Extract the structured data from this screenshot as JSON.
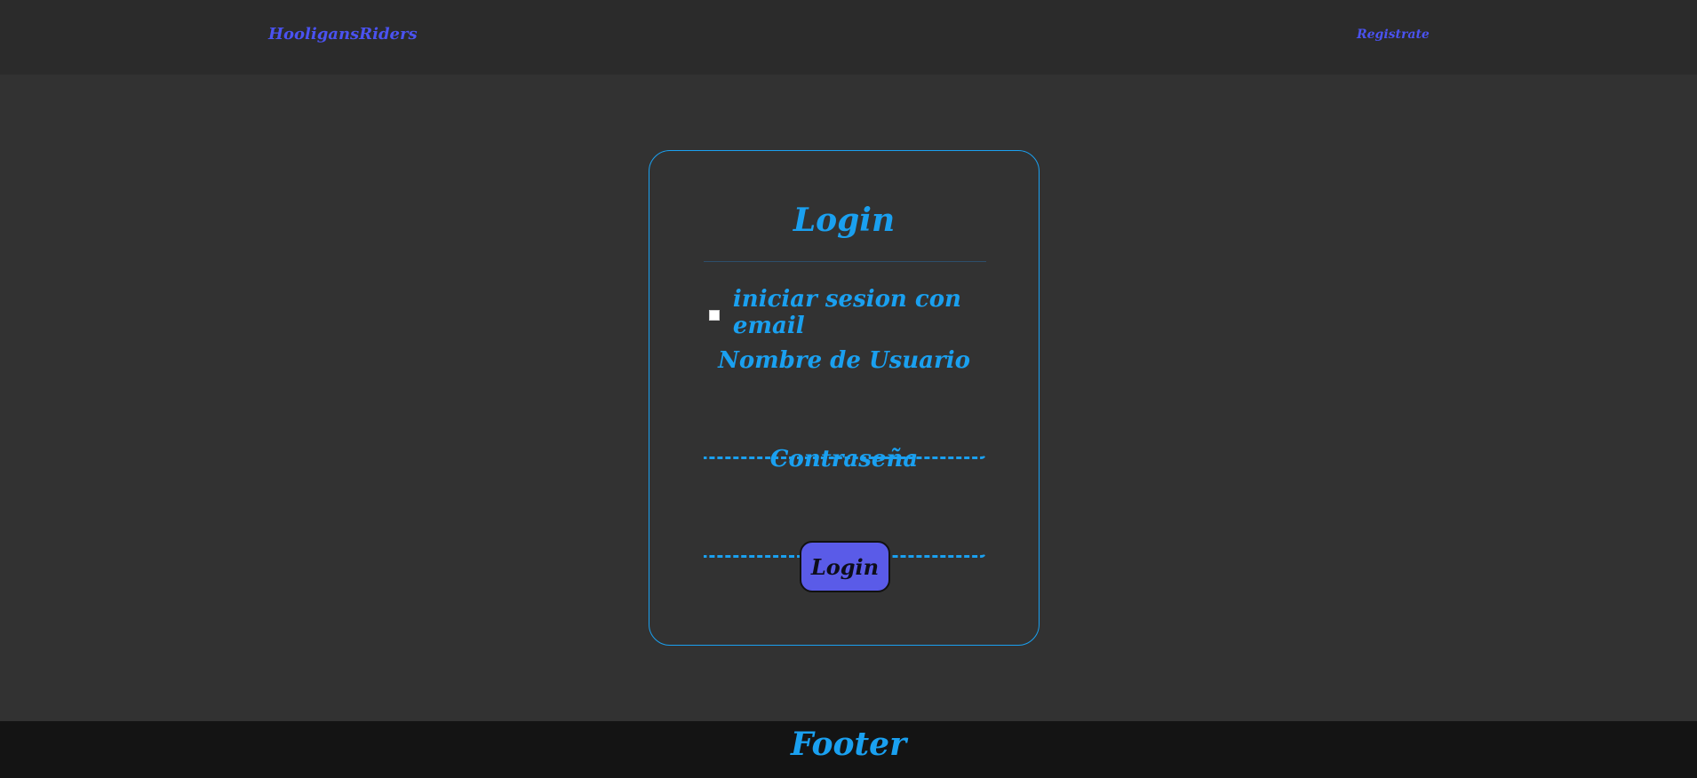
{
  "navbar": {
    "brand": "HooligansRiders",
    "register_link": "Registrate"
  },
  "login_card": {
    "title": "Login",
    "email_toggle_label": "iniciar sesion con email",
    "email_toggle_checked": false,
    "username_label": "Nombre de Usuario",
    "username_value": "",
    "password_label": "Contraseña",
    "password_value": "",
    "submit_label": "Login"
  },
  "footer": {
    "title": "Footer"
  },
  "colors": {
    "accent": "#1aa0f0",
    "brand": "#4a52f0",
    "button": "#5a5be8",
    "background": "#323232",
    "navbar": "#2b2b2b",
    "footer": "#141414"
  }
}
